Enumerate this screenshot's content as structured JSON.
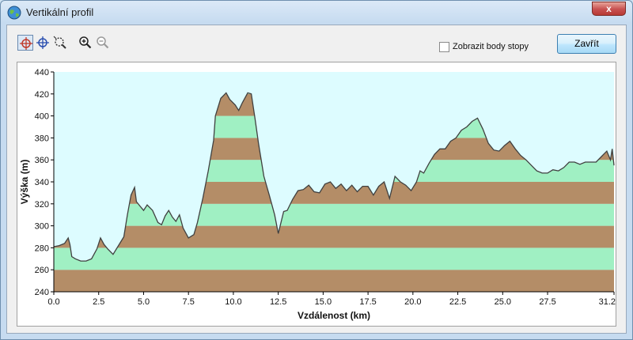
{
  "window": {
    "title": "Vertikální profil",
    "close_glyph": "x"
  },
  "toolbar": {
    "tools": [
      {
        "name": "crosshair-red-icon",
        "active": true
      },
      {
        "name": "crosshair-blue-icon",
        "active": false
      },
      {
        "name": "zoom-box-icon",
        "active": false
      },
      {
        "name": "zoom-in-icon",
        "active": false
      },
      {
        "name": "zoom-out-icon",
        "active": false
      }
    ],
    "show_points_label": "Zobrazit body stopy",
    "show_points_checked": false,
    "close_label": "Zavřít"
  },
  "colors": {
    "sky": "#ddfcff",
    "band_brown": "#b48d67",
    "band_green": "#a0f0c3",
    "line": "#404040",
    "axis": "#000000"
  },
  "chart_data": {
    "type": "area",
    "xlabel": "Vzdálenost  (km)",
    "ylabel": "Výška (m)",
    "xlim": [
      0,
      31.2
    ],
    "ylim": [
      240,
      440
    ],
    "xticks": [
      "0.0",
      "2.5",
      "5.0",
      "7.5",
      "10.0",
      "12.5",
      "15.0",
      "17.5",
      "20.0",
      "22.5",
      "25.0",
      "27.5",
      "31.2"
    ],
    "xtick_values": [
      0,
      2.5,
      5,
      7.5,
      10,
      12.5,
      15,
      17.5,
      20,
      22.5,
      25,
      27.5,
      31.2
    ],
    "yticks": [
      "240",
      "260",
      "280",
      "300",
      "320",
      "340",
      "360",
      "380",
      "400",
      "420",
      "440"
    ],
    "ytick_values": [
      240,
      260,
      280,
      300,
      320,
      340,
      360,
      380,
      400,
      420,
      440
    ],
    "bands_step": 20,
    "series": [
      {
        "x": [
          0,
          0.3,
          0.6,
          0.8,
          0.9,
          1.0,
          1.2,
          1.5,
          1.8,
          2.1,
          2.4,
          2.6,
          2.8,
          3.0,
          3.3,
          3.6,
          3.9,
          4.1,
          4.3,
          4.5,
          4.6,
          4.8,
          5.0,
          5.2,
          5.5,
          5.8,
          6.0,
          6.2,
          6.4,
          6.6,
          6.8,
          7.0,
          7.2,
          7.5,
          7.8,
          8.0,
          8.3,
          8.6,
          8.9,
          9.0,
          9.3,
          9.6,
          9.8,
          10.1,
          10.3,
          10.5,
          10.8,
          11.0,
          11.2,
          11.4,
          11.7,
          12.0,
          12.3,
          12.5,
          12.8,
          13.0,
          13.3,
          13.6,
          13.9,
          14.2,
          14.5,
          14.8,
          15.1,
          15.4,
          15.7,
          16.0,
          16.3,
          16.6,
          16.9,
          17.2,
          17.5,
          17.8,
          18.1,
          18.4,
          18.7,
          19.0,
          19.3,
          19.6,
          19.9,
          20.2,
          20.4,
          20.6,
          20.9,
          21.2,
          21.5,
          21.8,
          22.1,
          22.4,
          22.7,
          23.0,
          23.3,
          23.6,
          23.9,
          24.2,
          24.5,
          24.8,
          25.1,
          25.4,
          25.7,
          26.0,
          26.3,
          26.6,
          26.9,
          27.2,
          27.5,
          27.8,
          28.1,
          28.4,
          28.7,
          29.0,
          29.3,
          29.6,
          29.9,
          30.2,
          30.5,
          30.8,
          31.0,
          31.1,
          31.2
        ],
        "y": [
          281,
          282,
          284,
          289,
          283,
          272,
          270,
          268,
          268,
          270,
          279,
          289,
          283,
          279,
          274,
          282,
          290,
          310,
          328,
          335,
          322,
          318,
          314,
          319,
          314,
          303,
          301,
          309,
          314,
          308,
          304,
          310,
          298,
          289,
          292,
          303,
          325,
          350,
          378,
          400,
          416,
          421,
          415,
          410,
          405,
          412,
          421,
          420,
          398,
          375,
          345,
          328,
          310,
          293,
          313,
          314,
          324,
          332,
          333,
          337,
          331,
          330,
          338,
          340,
          334,
          338,
          332,
          337,
          331,
          336,
          336,
          328,
          336,
          340,
          325,
          345,
          340,
          337,
          332,
          340,
          350,
          348,
          357,
          365,
          370,
          370,
          377,
          380,
          387,
          390,
          395,
          398,
          388,
          375,
          369,
          368,
          373,
          377,
          370,
          364,
          360,
          355,
          350,
          348,
          348,
          351,
          350,
          353,
          358,
          358,
          356,
          358,
          358,
          358,
          363,
          368,
          360,
          370,
          355
        ]
      }
    ]
  }
}
